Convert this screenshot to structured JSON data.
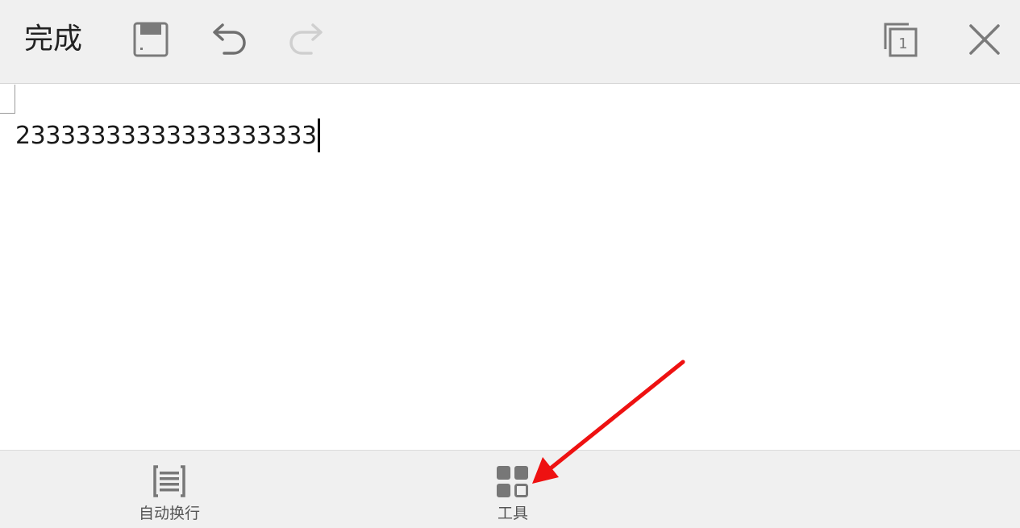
{
  "toolbar": {
    "done_label": "完成",
    "icons": [
      "save-icon",
      "undo-icon",
      "redo-icon",
      "page-count-icon",
      "close-icon"
    ],
    "page_count": "1"
  },
  "editor": {
    "text": "23333333333333333333"
  },
  "bottom_bar": {
    "items": [
      {
        "label": "自动换行",
        "icon": "word-wrap-icon"
      },
      {
        "label": "工具",
        "icon": "tools-grid-icon"
      }
    ]
  },
  "colors": {
    "toolbar_bg": "#f0f0f0",
    "icon_gray": "#7a7a7a",
    "disabled_gray": "#cfcfcf",
    "annotation_red": "#ee1111"
  }
}
